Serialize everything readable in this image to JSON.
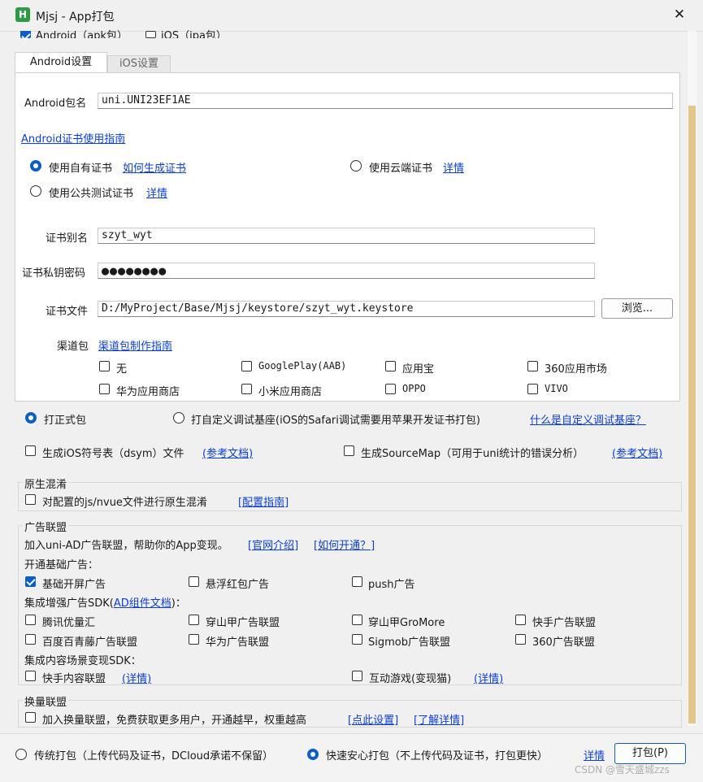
{
  "window": {
    "title": "Mjsj - App打包",
    "close_glyph": "✕",
    "app_icon_letter": "H",
    "accent": "#0a5ec8"
  },
  "top_options": {
    "android": "Android（apk包）",
    "ios": "iOS（ipa包）"
  },
  "tabs": [
    "Android设置",
    "iOS设置"
  ],
  "android": {
    "package_label": "Android包名",
    "package_value": "uni.UNI23EF1AE",
    "cert_guide": "Android证书使用指南",
    "own_cert": "使用自有证书",
    "own_cert_link": "如何生成证书",
    "cloud_cert": "使用云端证书",
    "cloud_cert_link": "详情",
    "public_cert": "使用公共测试证书",
    "public_cert_link": "详情",
    "alias_label": "证书别名",
    "alias_value": "szyt_wyt",
    "password_label": "证书私钥密码",
    "password_value": "●●●●●●●●",
    "file_label": "证书文件",
    "file_value": "D:/MyProject/Base/Mjsj/keystore/szyt_wyt.keystore",
    "browse": "浏览...",
    "channel_label": "渠道包",
    "channel_link": "渠道包制作指南",
    "channels": [
      "无",
      "GooglePlay(AAB)",
      "应用宝",
      "360应用市场",
      "华为应用商店",
      "小米应用商店",
      "OPPO",
      "VIVO"
    ]
  },
  "build_type": {
    "formal": "打正式包",
    "custom": "打自定义调试基座(iOS的Safari调试需要用苹果开发证书打包)",
    "custom_link": "什么是自定义调试基座？"
  },
  "symbols": {
    "dsym": "生成iOS符号表（dsym）文件",
    "dsym_link": "(参考文档)",
    "sourcemap": "生成SourceMap（可用于uni统计的错误分析）",
    "sourcemap_link": "(参考文档)"
  },
  "obfuscation": {
    "title": "原生混淆",
    "option": "对配置的js/nvue文件进行原生混淆",
    "link": "[配置指南]"
  },
  "ads": {
    "title": "广告联盟",
    "intro": "加入uni-AD广告联盟，帮助你的App变现。",
    "intro_link1": "[官网介绍]",
    "intro_link2": "[如何开通？]",
    "basic_label": "开通基础广告：",
    "basic": [
      "基础开屏广告",
      "悬浮红包广告",
      "push广告"
    ],
    "sdk_label_prefix": "集成增强广告SDK(",
    "sdk_link": "AD组件文档",
    "sdk_label_suffix": ")：",
    "sdk": [
      "腾讯优量汇",
      "穿山甲广告联盟",
      "穿山甲GroMore",
      "快手广告联盟",
      "百度百青藤广告联盟",
      "华为广告联盟",
      "Sigmob广告联盟",
      "360广告联盟"
    ],
    "content_label": "集成内容场景变现SDK：",
    "content": [
      "快手内容联盟",
      "互动游戏(变现猫)"
    ],
    "content_link": "(详情)"
  },
  "exchange": {
    "title": "换量联盟",
    "option": "加入换量联盟，免费获取更多用户，开通越早，权重越高",
    "link1": "[点此设置]",
    "link2": "[了解详情]"
  },
  "footer": {
    "traditional": "传统打包（上传代码及证书，DCloud承诺不保留）",
    "fast": "快速安心打包（不上传代码及证书，打包更快）",
    "detail_link": "详情",
    "pack_button": "打包(P)",
    "watermark": "CSDN @雪天盛城zzs"
  }
}
